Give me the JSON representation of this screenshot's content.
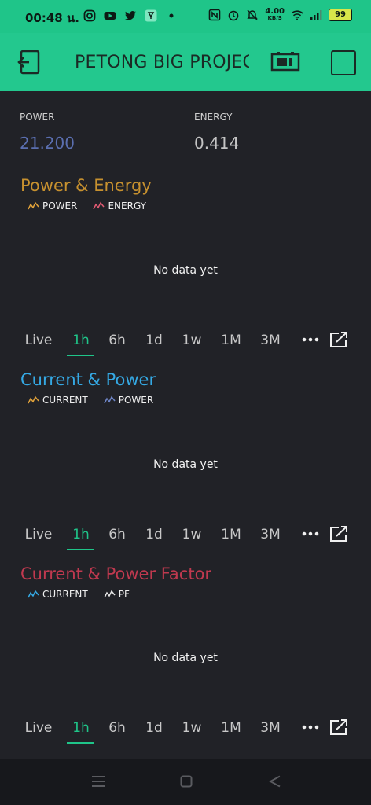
{
  "status_bar": {
    "time": "00:48 น.",
    "net_speed": "4.00",
    "net_unit": "KB/S",
    "battery": "99"
  },
  "app_bar": {
    "title": "PETONG BIG PROJECT"
  },
  "values": [
    {
      "label": "POWER",
      "value": "21.200",
      "color": "#5b6fb0"
    },
    {
      "label": "ENERGY",
      "value": "0.414",
      "color": "#c4c4c4"
    }
  ],
  "charts": [
    {
      "title": "Power & Energy",
      "title_color": "#c7912f",
      "legend": [
        {
          "label": "POWER",
          "color": "#e1a23a"
        },
        {
          "label": "ENERGY",
          "color": "#e05a72"
        }
      ],
      "empty_text": "No data yet"
    },
    {
      "title": "Current & Power",
      "title_color": "#35a9e4",
      "legend": [
        {
          "label": "CURRENT",
          "color": "#e1a23a"
        },
        {
          "label": "POWER",
          "color": "#6f86c8"
        }
      ],
      "empty_text": "No data yet"
    },
    {
      "title": "Current & Power Factor",
      "title_color": "#c0394f",
      "legend": [
        {
          "label": "CURRENT",
          "color": "#35a9e4"
        },
        {
          "label": "PF",
          "color": "#e8e8e8"
        }
      ],
      "empty_text": "No data yet"
    }
  ],
  "time_ranges": [
    "Live",
    "1h",
    "6h",
    "1d",
    "1w",
    "1M",
    "3M"
  ],
  "active_range": "1h"
}
